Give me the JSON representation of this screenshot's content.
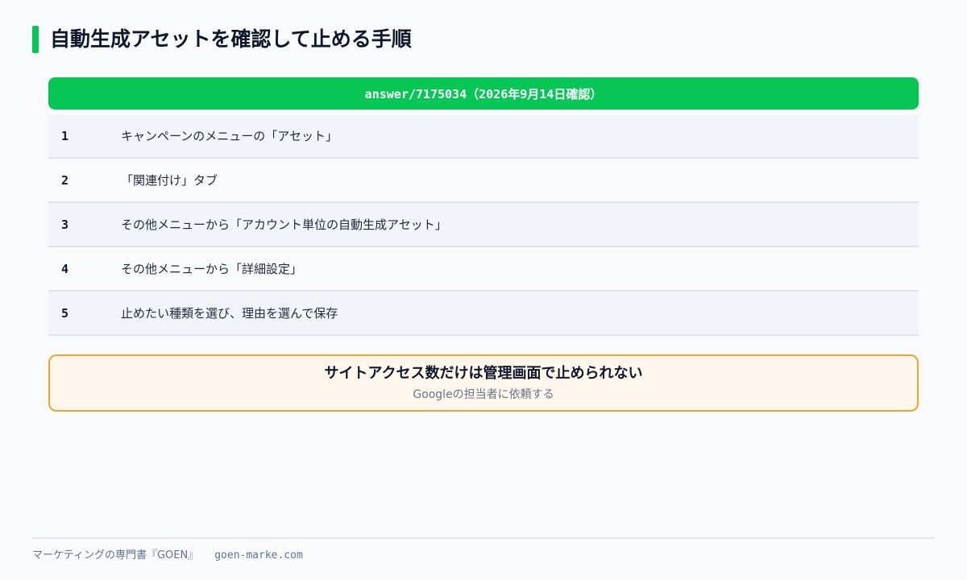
{
  "title": "自動生成アセットを確認して止める手順",
  "table": {
    "header": "answer/7175034（2026年9月14日確認）",
    "rows": [
      {
        "num": "1",
        "text": "キャンペーンのメニューの「アセット」"
      },
      {
        "num": "2",
        "text": "「関連付け」タブ"
      },
      {
        "num": "3",
        "text": "その他メニューから「アカウント単位の自動生成アセット」"
      },
      {
        "num": "4",
        "text": "その他メニューから「詳細設定」"
      },
      {
        "num": "5",
        "text": "止めたい種類を選び、理由を選んで保存"
      }
    ]
  },
  "callout": {
    "title": "サイトアクセス数だけは管理画面で止められない",
    "subtitle": "Googleの担当者に依頼する"
  },
  "footer": {
    "brand": "マーケティングの専門書『GOEN』",
    "site": "goen-marke.com"
  },
  "colors": {
    "accent": "#06c755",
    "callout_border": "#f0a330",
    "callout_bg": "#fff7ec"
  }
}
